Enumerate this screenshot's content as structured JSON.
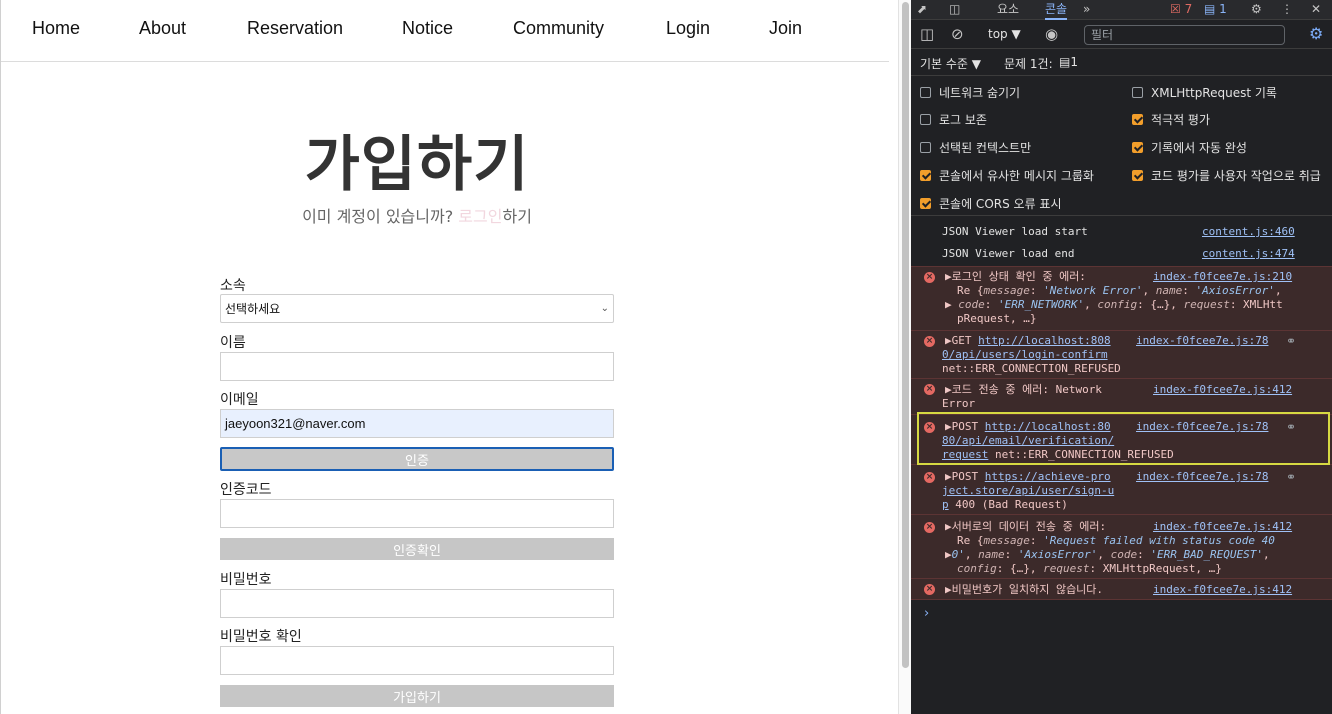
{
  "nav": {
    "items": [
      "Home",
      "About",
      "Reservation",
      "Notice",
      "Community",
      "Login",
      "Join"
    ]
  },
  "signup": {
    "title": "가입하기",
    "subtitle_prefix": "이미 계정이 있습니까? ",
    "subtitle_link": "로그인",
    "subtitle_suffix": "하기",
    "affiliation_label": "소속",
    "affiliation_value": "선택하세요",
    "name_label": "이름",
    "name_value": "",
    "email_label": "이메일",
    "email_value": "jaeyoon321@naver.com",
    "verify_button": "인증",
    "code_label": "인증코드",
    "code_value": "",
    "confirm_code_button": "인증확인",
    "password_label": "비밀번호",
    "password_confirm_label": "비밀번호 확인",
    "submit_button": "가입하기"
  },
  "devtools": {
    "tabs": [
      "요소",
      "콘솔"
    ],
    "active_tab": "콘솔",
    "more_tabs": "»",
    "error_count": "7",
    "info_count": "1",
    "context": "top ▼",
    "filter_placeholder": "필터",
    "level": "기본 수준 ▼",
    "issues": "문제 1건:",
    "issues_count": "1",
    "options": [
      {
        "label": "네트워크 숨기기",
        "checked": false
      },
      {
        "label": "XMLHttpRequest 기록",
        "checked": false
      },
      {
        "label": "로그 보존",
        "checked": false
      },
      {
        "label": "적극적 평가",
        "checked": true
      },
      {
        "label": "선택된 컨텍스트만",
        "checked": false
      },
      {
        "label": "기록에서 자동 완성",
        "checked": true
      },
      {
        "label": "콘솔에서 유사한 메시지 그룹화",
        "checked": true
      },
      {
        "label": "코드 평가를 사용자 작업으로 취급",
        "checked": true
      },
      {
        "label": "콘솔에 CORS 오류 표시",
        "checked": true
      }
    ],
    "logs": [
      {
        "text": "JSON Viewer load start",
        "src": "content.js:460"
      },
      {
        "text": "JSON Viewer load end",
        "src": "content.js:474"
      },
      {
        "text": "▶로그인 상태 확인 중 에러:",
        "src": "index-f0fcee7e.js:210",
        "l2a": "Re {",
        "l2b": "message",
        "l2c": ": ",
        "l2d": "'Network Error'",
        "l2e": ", ",
        "l2f": "name",
        "l2g": ": ",
        "l2h": "'AxiosError'",
        "l2i": ",",
        "l3a": "▶ ",
        "l3b": "code",
        "l3c": ": ",
        "l3d": "'ERR_NETWORK'",
        "l3e": ", ",
        "l3f": "config",
        "l3g": ": {…}, ",
        "l3h": "request",
        "l3i": ": XMLHtt",
        "l4": "pRequest, …}"
      },
      {
        "text": "▶GET ",
        "url1": "http://localhost:808",
        "url2": "0/api/users/login-confirm",
        "tail": "net::ERR_CONNECTION_REFUSED",
        "src": "index-f0fcee7e.js:78"
      },
      {
        "text": "▶코드 전송 중 에러: Network",
        "text2": "Error",
        "src": "index-f0fcee7e.js:412"
      },
      {
        "text": "▶POST ",
        "url1": "http://localhost:80",
        "url2": "80/api/email/verification/",
        "url3": "request",
        "tail": " net::ERR_CONNECTION_REFUSED",
        "src": "index-f0fcee7e.js:78"
      },
      {
        "text": "▶POST ",
        "url1": "https://achieve-pro",
        "url2": "ject.store/api/user/sign-u",
        "url3": "p",
        "tail": " 400 (Bad Request)",
        "src": "index-f0fcee7e.js:78"
      },
      {
        "text": "▶서버로의 데이터 전송 중 에러:",
        "src": "index-f0fcee7e.js:412",
        "l2a": "Re {",
        "l2b": "message",
        "l2c": ": ",
        "l2d": "'Request failed with status code 40",
        "l3a": "▶",
        "l3b": "0'",
        "l3c": ", ",
        "l3d": "name",
        "l3e": ": ",
        "l3f": "'AxiosError'",
        "l3g": ", ",
        "l3h": "code",
        "l3i": ": ",
        "l3j": "'ERR_BAD_REQUEST'",
        "l3k": ",",
        "l4a": "config",
        "l4b": ": {…}, ",
        "l4c": "request",
        "l4d": ": XMLHttpRequest, …}"
      },
      {
        "text": "▶비밀번호가 일치하지 않습니다.",
        "src": "index-f0fcee7e.js:412"
      }
    ],
    "prompt": "›"
  }
}
